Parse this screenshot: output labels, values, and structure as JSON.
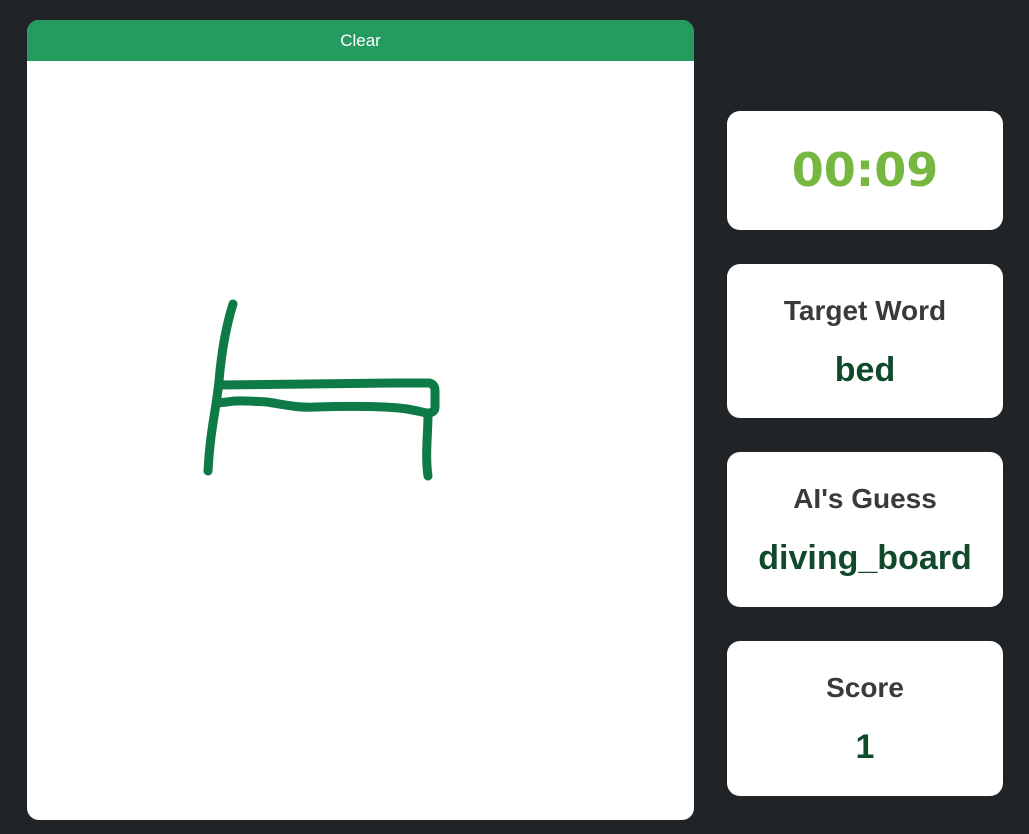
{
  "canvas": {
    "clear_label": "Clear",
    "stroke_color": "#0e7a45"
  },
  "timer": {
    "value": "00:09",
    "color": "#76b83f"
  },
  "target": {
    "label": "Target Word",
    "value": "bed"
  },
  "guess": {
    "label": "AI's Guess",
    "value": "diving_board"
  },
  "score": {
    "label": "Score",
    "value": "1"
  },
  "colors": {
    "background": "#212427",
    "accent": "#259b5f",
    "value_text": "#114a2b"
  }
}
